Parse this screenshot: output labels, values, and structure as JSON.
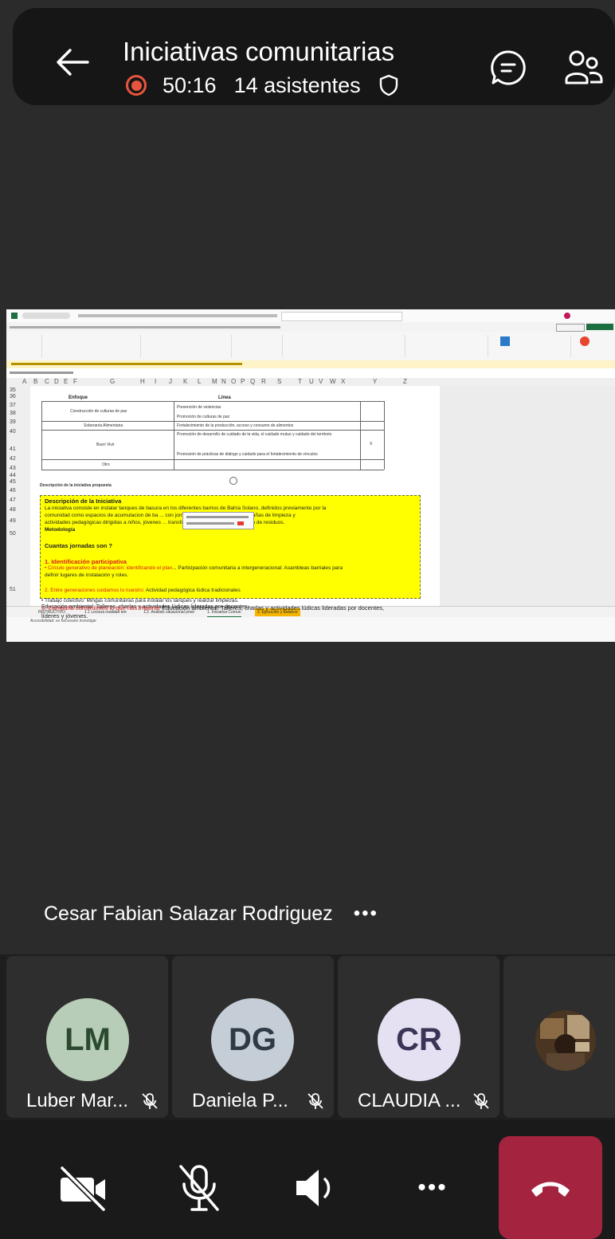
{
  "header": {
    "title": "Iniciativas comunitarias",
    "elapsed": "50:16",
    "attendees": "14 asistentes",
    "icons": [
      "back-arrow-icon",
      "recording-icon",
      "shield-icon",
      "chat-icon",
      "people-icon"
    ]
  },
  "share": {
    "columns": [
      "A",
      "B",
      "C",
      "D",
      "E",
      "F",
      "G",
      "H",
      "I",
      "J",
      "K",
      "L",
      "M",
      "N",
      "O",
      "P",
      "Q",
      "R",
      "S",
      "T",
      "U",
      "V",
      "W",
      "X",
      "Y",
      "Z"
    ],
    "rows": [
      "35",
      "36",
      "37",
      "38",
      "39",
      "40",
      "41",
      "42",
      "43",
      "44",
      "45",
      "46",
      "47",
      "48",
      "49",
      "50",
      "51"
    ],
    "table_header_enfoque": "Enfoque",
    "table_header_linea": "Línea",
    "enfoques": [
      "Construcción de culturas de paz",
      "Soberanía Alimentaria",
      "Buen Vivir",
      "Otro"
    ],
    "lineas": [
      "Prevención de violencias",
      "Promoción de culturas de paz",
      "Fortalecimiento de la producción, acceso y consumo de alimentos",
      "Promoción de desarrollo de cuidado de la vida, el cuidado mutuo y cuidado del territorio",
      "Promoción de prácticas de diálogo y cuidado para el fortalecimiento de vínculos"
    ],
    "mark_value": "X",
    "section_label": "Descripción de la iniciativa propuesta",
    "textbox": {
      "heading": "Descripción de la Iniciativa",
      "line1": "La iniciativa consiste en instalar tanques de basura en los diferentes barrios de Bahía Solano, definidos previamente por la",
      "line2": "comunidad como espacios de acumulacion de ba ... con jornadas de sensibilización, campañas de limpieza y",
      "line3": "actividades pedagógicas dirigidas a niños, jóvenes ... transformar los hábitos de disposición de residuos.",
      "metodologia": "Metodología",
      "question": "Cuantas jornadas son ?",
      "step1_title": "1. Identificación participativa",
      "step1_red": "• Círculo generativo de planeación: identificando el plan",
      "step1_rest": "... Participación comunitaria a intergeneracional: Asambleas barriales para",
      "step1_line2": "definir lugares de instalación y roles.",
      "step2_red": "2. Entre generaciones cuidamos lo nuestro:",
      "step2_rest": " Actividad pedagógica lúdica tradicionales",
      "step2b": "• Trabajo colectivo: Mingas comunitarias para instalar los tanques y realizar limpiezas.",
      "step3_red": "3. Campaña construimos lo que nos importa:",
      "step3_rest": " Educación ambiental: Talleres, charlas y actividades lúdicas lideradas por docentes,",
      "step3_line2": "líderes y jóvenes."
    },
    "sheet_tabs": [
      "INSTRUCTIVO",
      "1.1 Lectura realidad terr",
      "1.2. Análisis situacional prioir",
      "1. Iniciativa Comun",
      "2. Ejecución y Balance"
    ],
    "status_text": "Accesibilidad: es necesario investigar"
  },
  "speaker": {
    "name": "Cesar Fabian Salazar Rodriguez",
    "more": "•••"
  },
  "participants": [
    {
      "initials": "LM",
      "name": "Luber Mar...",
      "color": "#b7cdb7",
      "text_color": "#2c4a2f"
    },
    {
      "initials": "DG",
      "name": "Daniela  P...",
      "color": "#c5ced6",
      "text_color": "#2e3a45"
    },
    {
      "initials": "CR",
      "name": "CLAUDIA ...",
      "color": "#e5e1f2",
      "text_color": "#3a3456"
    }
  ],
  "controls": {
    "icons": [
      "camera-off-icon",
      "mic-off-icon",
      "speaker-icon",
      "more-icon",
      "end-call-icon"
    ],
    "more": "•••",
    "end_call_color": "#a4233f"
  }
}
